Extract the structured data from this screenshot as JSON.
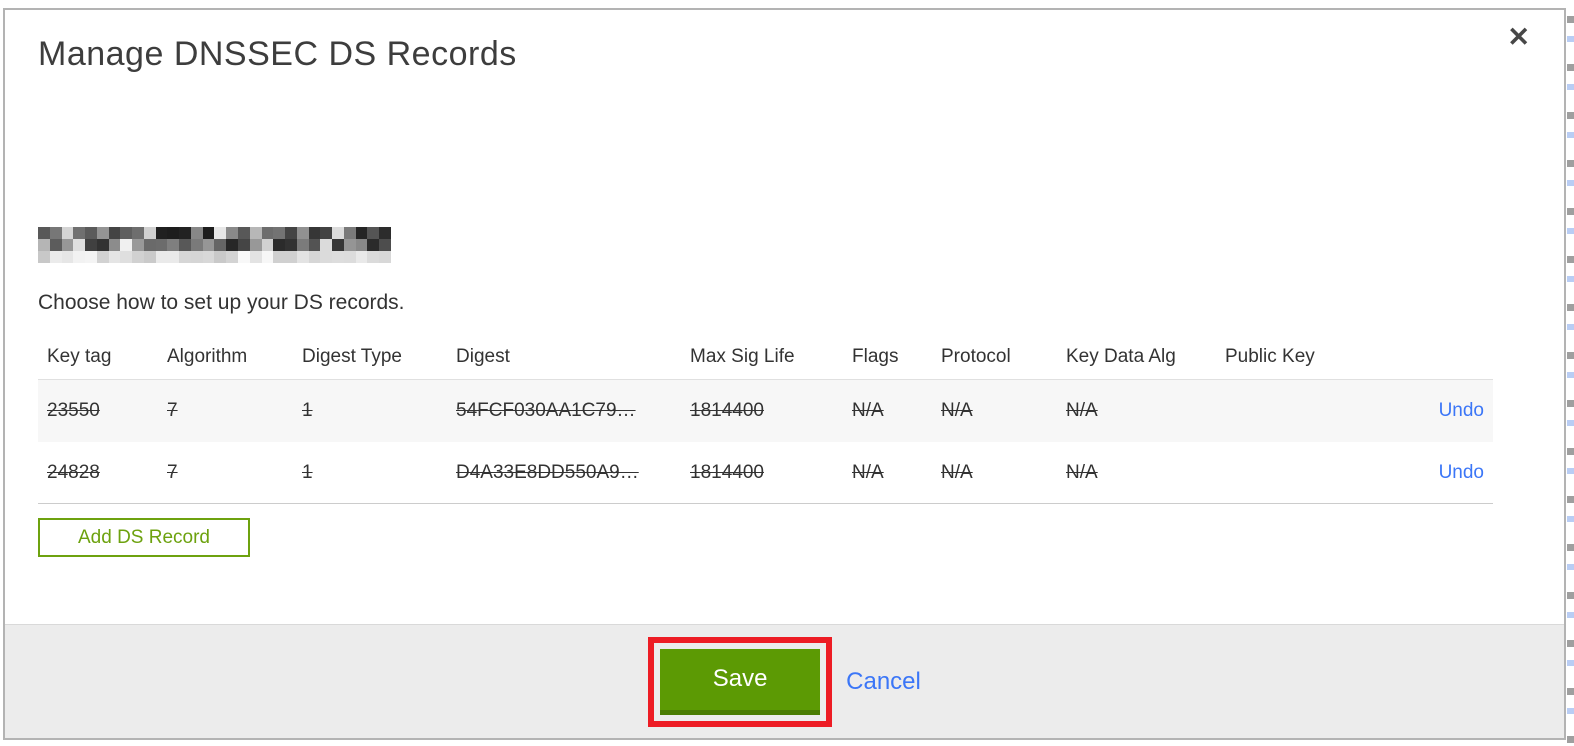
{
  "colors": {
    "accent_green": "#5c9a04",
    "accent_green_dark": "#4a7d03",
    "outline_green": "#6da20f",
    "link_blue": "#3b76f7",
    "annotation_red": "#ed1c24",
    "footer_gray": "#ececec"
  },
  "modal": {
    "title": "Manage DNSSEC DS Records",
    "close_glyph": "✕",
    "subtitle": "Choose how to set up your DS records.",
    "redacted_domain": {
      "rows": 3,
      "cols": 30
    },
    "table": {
      "columns": [
        "Key tag",
        "Algorithm",
        "Digest Type",
        "Digest",
        "Max Sig Life",
        "Flags",
        "Protocol",
        "Key Data Alg",
        "Public Key"
      ],
      "rows": [
        {
          "cells": [
            "23550",
            "7",
            "1",
            "54FCF030AA1C79…",
            "1814400",
            "N/A",
            "N/A",
            "N/A",
            ""
          ],
          "action": "Undo"
        },
        {
          "cells": [
            "24828",
            "7",
            "1",
            "D4A33E8DD550A9…",
            "1814400",
            "N/A",
            "N/A",
            "N/A",
            ""
          ],
          "action": "Undo"
        }
      ]
    },
    "add_button_label": "Add DS Record",
    "footer": {
      "save_label": "Save",
      "cancel_label": "Cancel"
    }
  }
}
